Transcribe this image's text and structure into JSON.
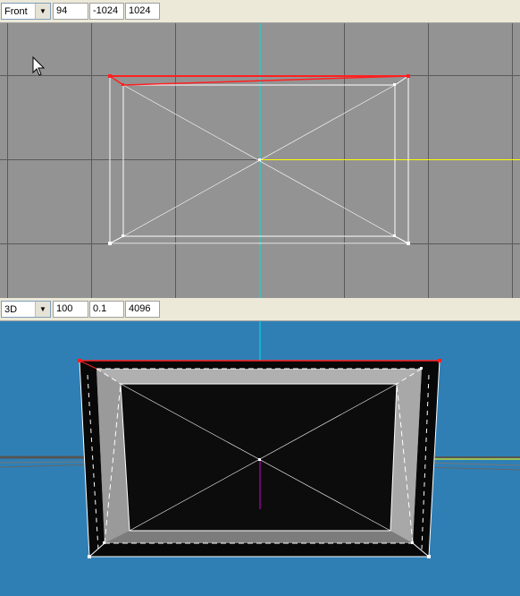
{
  "top_view": {
    "mode_label": "Front",
    "fields": [
      "94",
      "-1024",
      "1024"
    ]
  },
  "bottom_view": {
    "mode_label": "3D",
    "fields": [
      "100",
      "0.1",
      "4096"
    ]
  },
  "colors": {
    "ortho_background": "#939393",
    "grid_line": "#5a5a5a",
    "perspective_background": "#2f7fb5",
    "axis_cyan": "#00e0e0",
    "axis_yellow": "#ffff00",
    "selected_edge_red": "#ff2020",
    "wire_white": "#ffffff"
  }
}
